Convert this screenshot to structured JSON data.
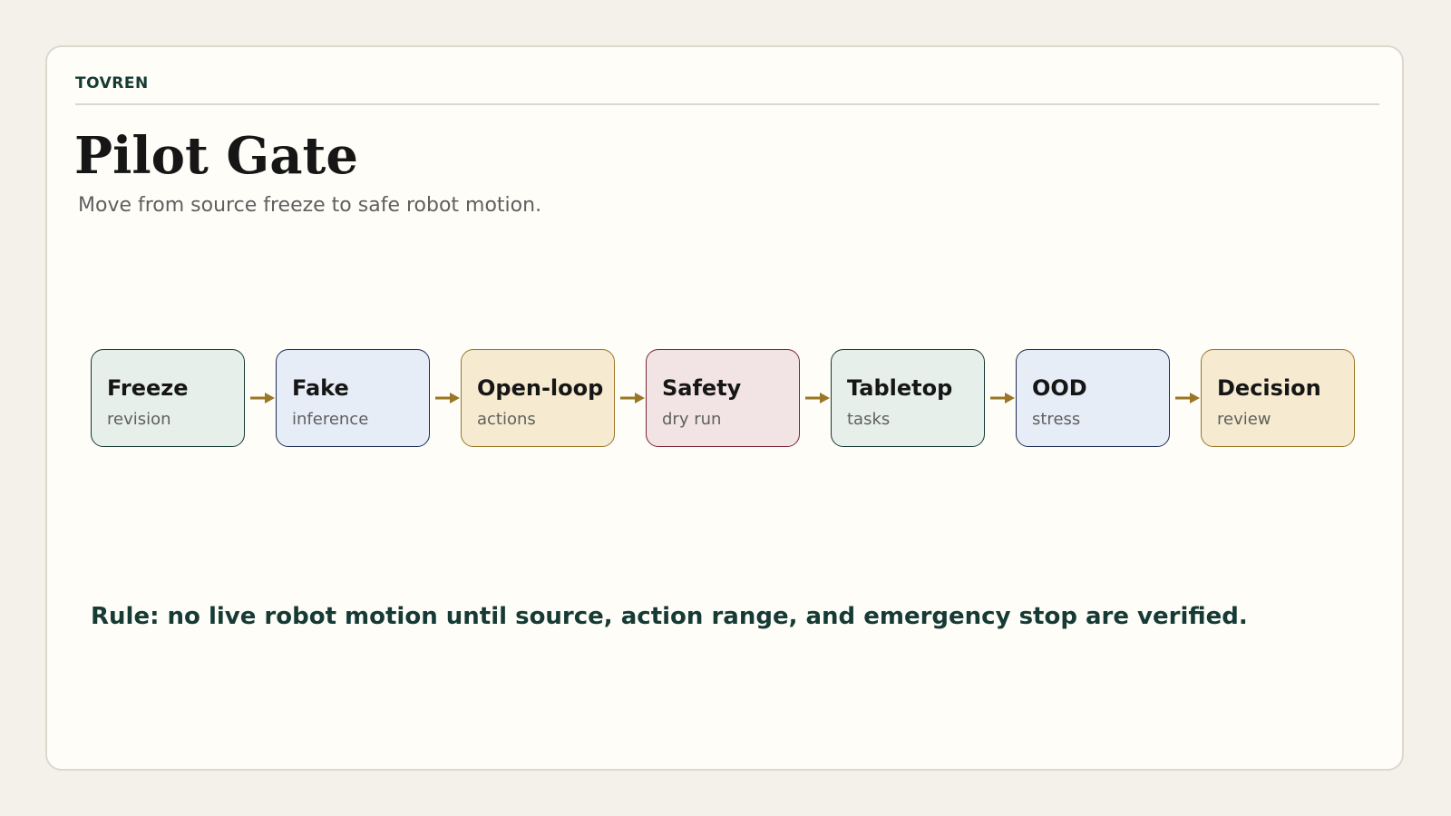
{
  "brand": "TOVREN",
  "title": "Pilot Gate",
  "subtitle": "Move from source freeze to safe robot motion.",
  "steps": [
    {
      "title": "Freeze",
      "sub": "revision",
      "fill": "#e6efea",
      "stroke": "#163a34"
    },
    {
      "title": "Fake",
      "sub": "inference",
      "fill": "#e6edf7",
      "stroke": "#1d2d55"
    },
    {
      "title": "Open-loop",
      "sub": "actions",
      "fill": "#f6ebd0",
      "stroke": "#9a7626"
    },
    {
      "title": "Safety",
      "sub": "dry run",
      "fill": "#f2e3e5",
      "stroke": "#7a2538"
    },
    {
      "title": "Tabletop",
      "sub": "tasks",
      "fill": "#e6efea",
      "stroke": "#163a34"
    },
    {
      "title": "OOD",
      "sub": "stress",
      "fill": "#e6edf7",
      "stroke": "#1d2d55"
    },
    {
      "title": "Decision",
      "sub": "review",
      "fill": "#f6ebd0",
      "stroke": "#9a7626"
    }
  ],
  "arrow_color": "#9a7626",
  "rule": "Rule: no live robot motion until source, action range, and emergency stop are verified."
}
